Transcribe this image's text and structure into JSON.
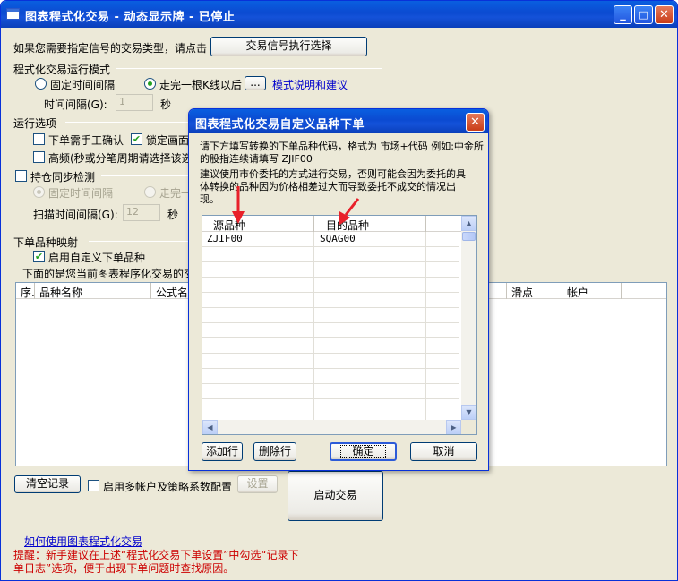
{
  "window": {
    "title": "图表程式化交易 - 动态显示牌 - 已停止",
    "controls": {
      "minimize": "_",
      "maximize": "□",
      "close": "✕"
    }
  },
  "signal": {
    "prompt": "如果您需要指定信号的交易类型，请点击",
    "button": "交易信号执行选择"
  },
  "run_mode": {
    "section": "程式化交易运行模式",
    "fixed_interval": "固定时间间隔",
    "after_kline": "走完一根K线以后",
    "more_btn": "...",
    "mode_link": "模式说明和建议",
    "interval_label": "时间间隔(G):",
    "interval_value": "1",
    "interval_unit": "秒"
  },
  "options": {
    "section": "运行选项",
    "manual_confirm": "下单需手工确认",
    "lock_screen": "锁定画面",
    "high_freq": "高频(秒或分笔周期请选择该选"
  },
  "position_sync": {
    "label": "持仓同步检测",
    "fixed_interval": "固定时间间隔",
    "after": "走完一",
    "scan_label": "扫描时间间隔(G):",
    "scan_value": "12",
    "scan_unit": "秒"
  },
  "mapping": {
    "section": "下单品种映射",
    "enable": "启用自定义下单品种",
    "desc": "下面的是您当前图表程序化交易的交"
  },
  "main_table": {
    "columns": [
      "序.",
      "品种名称",
      "公式名",
      "滑点",
      "帐户"
    ]
  },
  "bottom": {
    "clear_btn": "清空记录",
    "multi_account": "启用多帐户及策略系数配置",
    "settings_btn": "设置",
    "start_btn": "启动交易",
    "howto_link": "如何使用图表程式化交易",
    "tip": "提醒：新手建议在上述“程式化交易下单设置”中勾选“记录下单日志”选项，便于出现下单问题时查找原因。"
  },
  "dialog": {
    "title": "图表程式化交易自定义品种下单",
    "close": "✕",
    "instruction1": "请下方填写转换的下单品种代码，格式为 市场+代码 例如:中金所的股指连续请填写 ZJIF00",
    "instruction2": "建议使用市价委托的方式进行交易，否则可能会因为委托的具体转换的品种因为价格相差过大而导致委托不成交的情况出现。",
    "columns": [
      "源品种",
      "目的品种"
    ],
    "rows": [
      {
        "source": "ZJIF00",
        "target": "SQAG00"
      }
    ],
    "add_btn": "添加行",
    "delete_btn": "删除行",
    "ok_btn": "确定",
    "cancel_btn": "取消"
  },
  "colors": {
    "titlebar": "#0b4ad1",
    "face": "#ece9d8",
    "tip_red": "#cc0000",
    "link_blue": "#0000cc",
    "annotation_red": "#e8202a"
  }
}
